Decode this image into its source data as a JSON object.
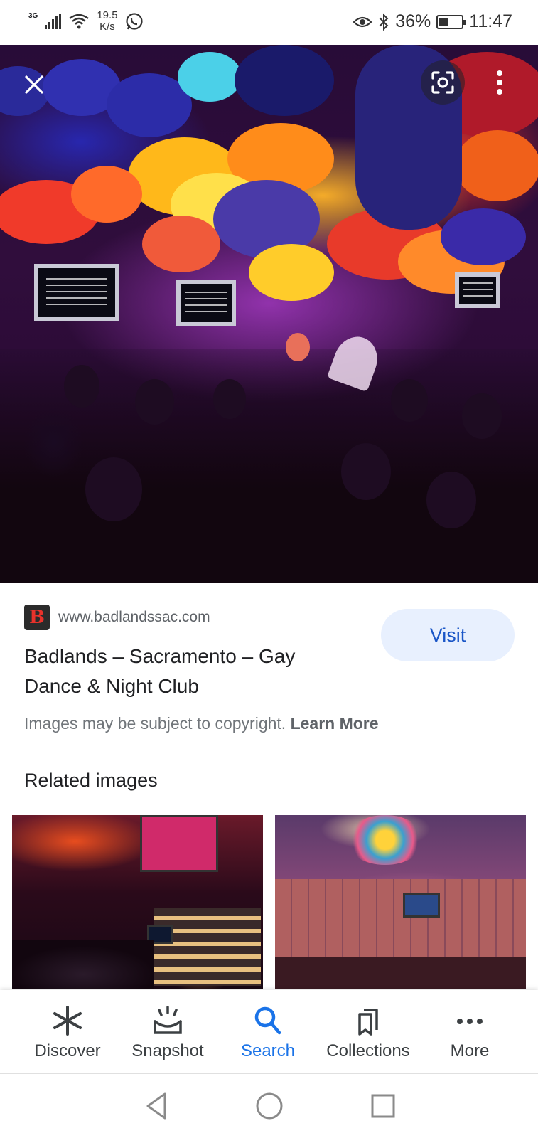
{
  "status_bar": {
    "network": "3G",
    "speed_value": "19.5",
    "speed_unit": "K/s",
    "battery": "36%",
    "time": "11:47"
  },
  "hero": {
    "icons": [
      "close-icon",
      "lens-icon",
      "more-vert-icon"
    ]
  },
  "result": {
    "favicon_letter": "B",
    "favicon_color": "#e8322b",
    "url": "www.badlandssac.com",
    "title": "Badlands – Sacramento – Gay Dance & Night Club",
    "visit_label": "Visit",
    "copyright_text": "Images may be subject to copyright.",
    "learn_more": "Learn More"
  },
  "related": {
    "title": "Related images"
  },
  "bottom_nav": {
    "active_color": "#1a73e8",
    "items": [
      {
        "label": "Discover",
        "icon": "asterisk-icon"
      },
      {
        "label": "Snapshot",
        "icon": "snapshot-icon"
      },
      {
        "label": "Search",
        "icon": "search-icon"
      },
      {
        "label": "Collections",
        "icon": "collections-icon"
      },
      {
        "label": "More",
        "icon": "more-horiz-icon"
      }
    ]
  },
  "system_nav": [
    "back-icon",
    "home-icon",
    "recents-icon"
  ]
}
